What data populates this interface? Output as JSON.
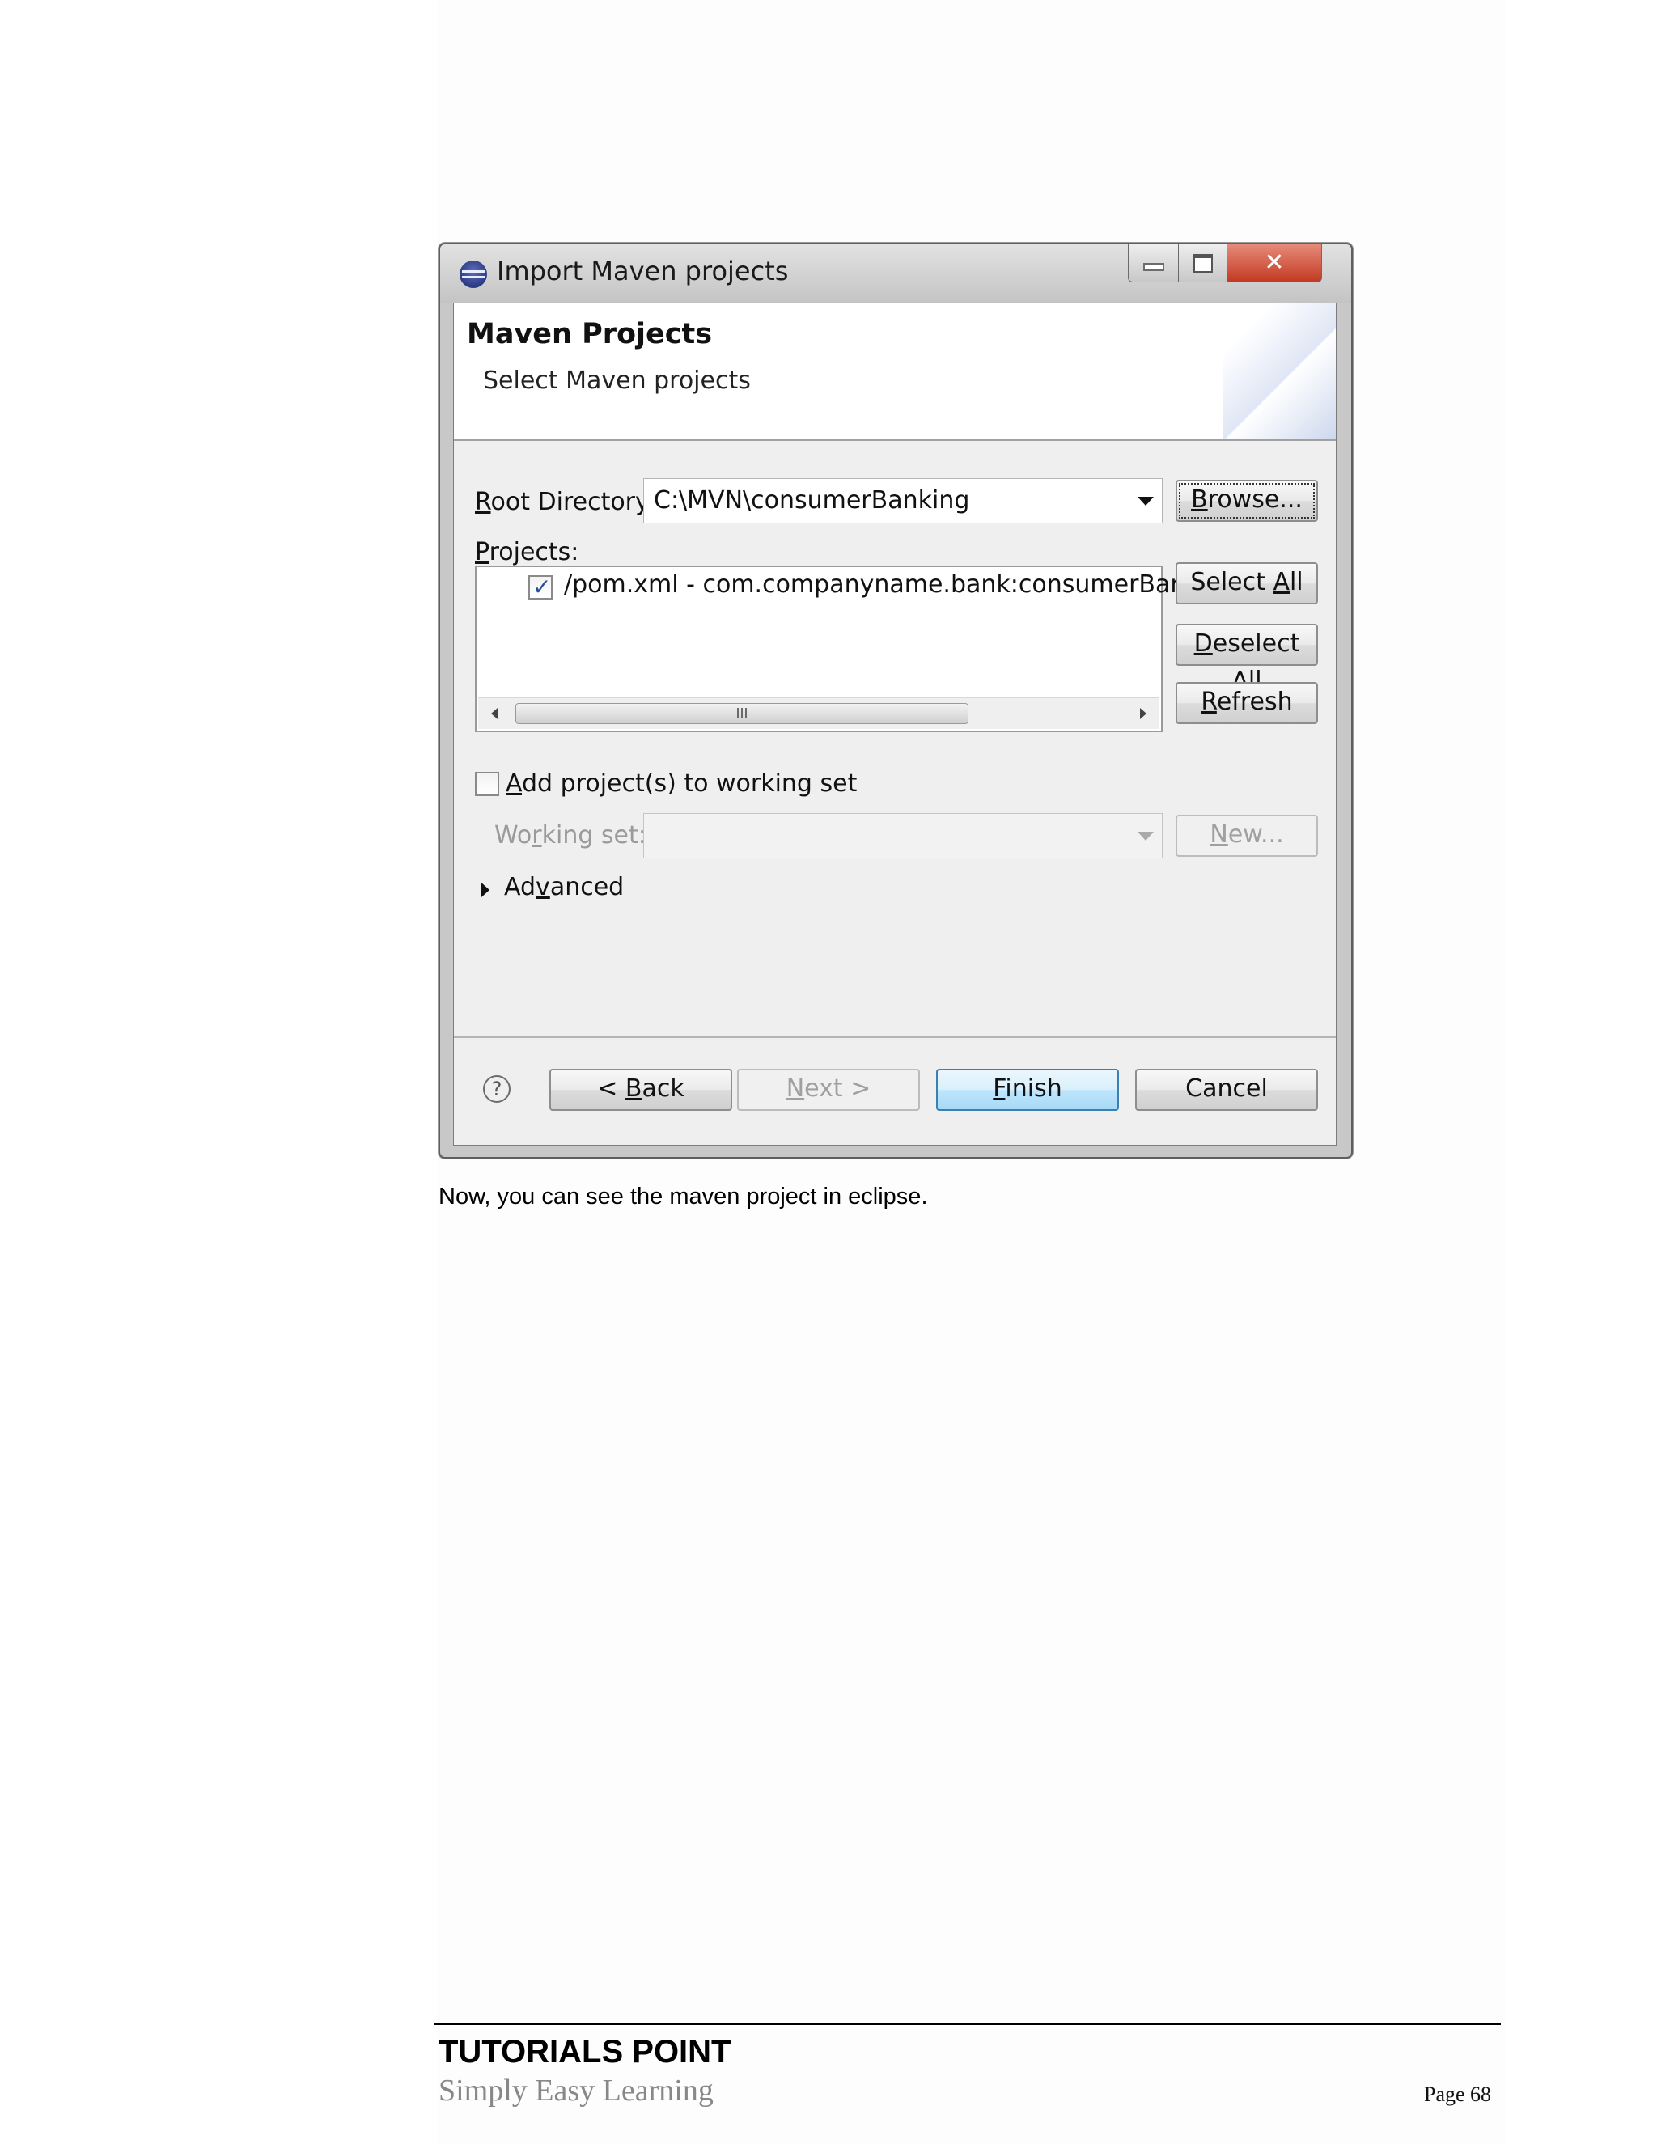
{
  "dialog": {
    "title": "Import Maven projects",
    "wizard_title": "Maven Projects",
    "wizard_subtitle": "Select Maven projects",
    "root_directory": {
      "label_access": "R",
      "label_rest": "oot Directory:",
      "value": "C:\\MVN\\consumerBanking",
      "browse_access": "B",
      "browse_rest": "rowse..."
    },
    "projects": {
      "label_access": "P",
      "label_rest": "rojects:",
      "items": [
        {
          "checked": true,
          "text": "/pom.xml - com.companyname.bank:consumerBankin"
        }
      ],
      "scroll_thumb": "III"
    },
    "side_buttons": {
      "select_all_pre": "Select ",
      "select_all_access": "A",
      "select_all_rest": "ll",
      "deselect_all_access": "D",
      "deselect_all_rest": "eselect All",
      "refresh_access": "R",
      "refresh_rest": "efresh"
    },
    "working_set": {
      "checkbox_access": "A",
      "checkbox_rest": "dd project(s) to working set",
      "checked": false,
      "label_pre": "Wo",
      "label_access": "r",
      "label_rest": "king set:",
      "value": "",
      "new_access": "N",
      "new_rest": "ew..."
    },
    "advanced": {
      "pre": "Ad",
      "access": "v",
      "rest": "anced"
    },
    "footer": {
      "help": "?",
      "back_pre": "< ",
      "back_access": "B",
      "back_rest": "ack",
      "next_access": "N",
      "next_rest": "ext >",
      "finish_access": "F",
      "finish_rest": "inish",
      "cancel": "Cancel"
    }
  },
  "caption": "Now, you can see the maven project in eclipse.",
  "page_footer": {
    "brand": "TUTORIALS POINT",
    "tagline": "Simply Easy Learning",
    "page": "Page 68"
  }
}
